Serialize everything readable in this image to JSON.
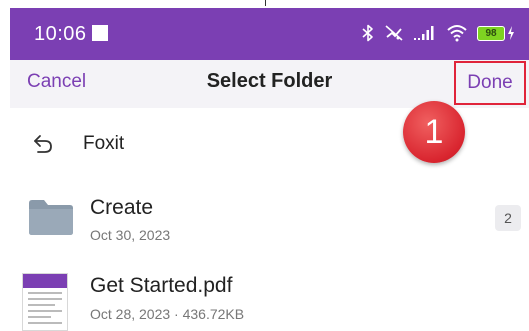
{
  "status_bar": {
    "time": "10:06",
    "battery": "98",
    "icons": [
      "bluetooth-icon",
      "mute-icon",
      "signal-icon",
      "wifi-icon",
      "battery-icon",
      "charging-icon"
    ]
  },
  "header": {
    "cancel_label": "Cancel",
    "title": "Select Folder",
    "done_label": "Done"
  },
  "annotation": {
    "step": "1"
  },
  "back_row": {
    "label": "Foxit"
  },
  "items": [
    {
      "type": "folder",
      "name": "Create",
      "date": "Oct 30, 2023",
      "count": "2"
    },
    {
      "type": "file",
      "name": "Get Started.pdf",
      "date": "Oct 28, 2023",
      "size": "436.72KB",
      "meta": "Oct 28, 2023 · 436.72KB"
    }
  ],
  "colors": {
    "brand_purple": "#7b3fb3",
    "highlight_red": "#e0243a",
    "nav_background": "#f4f3f7",
    "battery_green": "#7ed321"
  }
}
